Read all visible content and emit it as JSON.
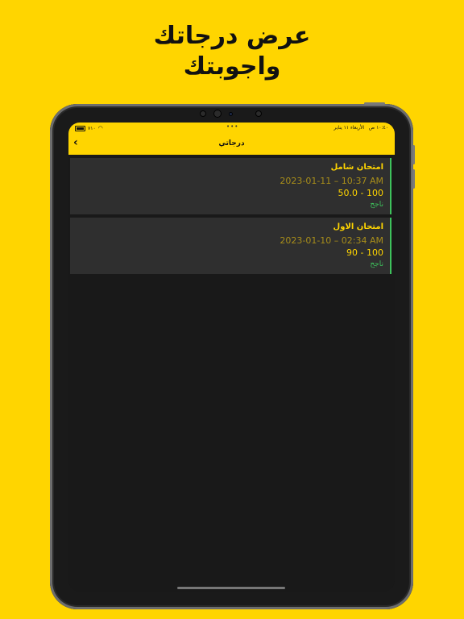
{
  "promo": {
    "line1": "عرض درجاتك",
    "line2": "واجوبتك"
  },
  "status_bar": {
    "time": "١٠:٤٠ ص",
    "date": "الأربعاء ١١ يناير",
    "battery": "٧١٠"
  },
  "app_bar": {
    "title": "درجاتي",
    "back_icon": "chevron-left-icon"
  },
  "results": [
    {
      "title": "امتحان شامل",
      "datetime": "2023-01-11 – 10:37 AM",
      "score": "50.0 - 100",
      "status": "ناجح"
    },
    {
      "title": "امتحان الاول",
      "datetime": "2023-01-10 – 02:34 AM",
      "score": "90 - 100",
      "status": "ناجح"
    }
  ],
  "colors": {
    "brand": "#FFD500",
    "card_bg": "#2F2F2F",
    "success": "#3EC25C",
    "screen_bg": "#191919"
  }
}
